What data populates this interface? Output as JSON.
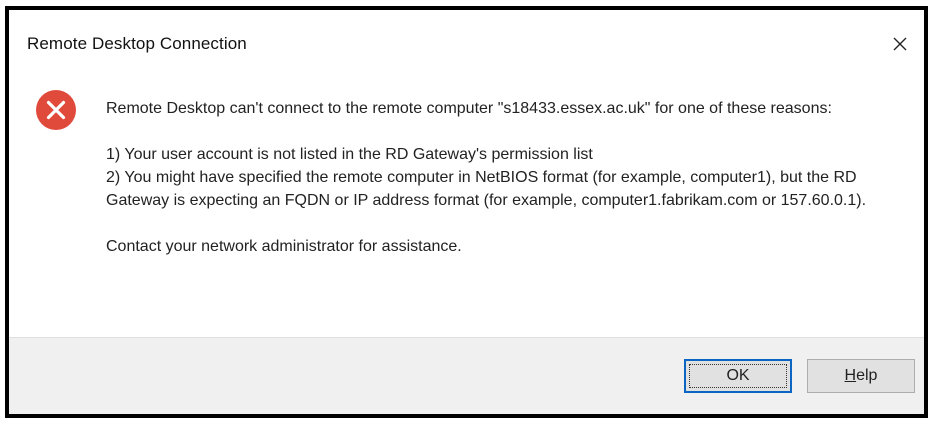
{
  "window": {
    "title": "Remote Desktop Connection",
    "close_icon": "close-icon"
  },
  "dialog": {
    "icon": "error-icon",
    "icon_color": "#e81123",
    "message_line1": "Remote Desktop can't connect to the remote computer \"s18433.essex.ac.uk\" for one of these reasons:",
    "reason1": "1) Your user account is not listed in the RD Gateway's permission list",
    "reason2": "2) You might have specified the remote computer in NetBIOS format (for example, computer1), but the RD Gateway is expecting an FQDN or IP address format (for example, computer1.fabrikam.com or 157.60.0.1).",
    "contact": "Contact your network administrator for assistance."
  },
  "buttons": {
    "ok_label": "OK",
    "help_label_mnemonic": "H",
    "help_label_rest": "elp"
  }
}
